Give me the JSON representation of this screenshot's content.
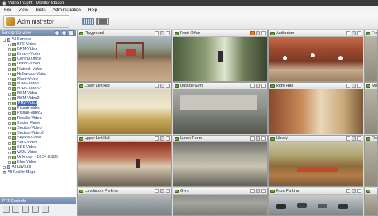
{
  "window": {
    "title": "Video Insight - Monitor Station"
  },
  "menu": [
    "File",
    "View",
    "Tools",
    "Administration",
    "Help"
  ],
  "toolbar": {
    "mode_label": "Administrator"
  },
  "sidebar": {
    "header": "Enterprise view",
    "tree": {
      "root": "All Servers",
      "servers": [
        "BFE-Video",
        "BPM-Video",
        "Bryant-Video",
        "Central Office",
        "Dalton-Video",
        "Flatrock-Video",
        "Hollywood-Video",
        "Mace-Video",
        "NJHS-Video",
        "NJHS-Video2",
        "NSM-Video",
        "NSM-Video2",
        "PRV-Video",
        "Pisgah-Video",
        "Pisgah-Video2",
        "Rosalie-Video",
        "Sevier-Video",
        "Section-Video",
        "Section-Video2",
        "Skyline-Video",
        "SMS-Video",
        "SES-Video",
        "WDV-Video",
        "Unknown - 10.34.8.100",
        "Blue-Video"
      ],
      "selected": "PRV-Video",
      "extra": [
        "All Layouts",
        "All Facility Maps"
      ]
    },
    "ptz_header": "PTZ Controls"
  },
  "cameras": [
    {
      "name": "Playground",
      "recording": false
    },
    {
      "name": "Front Office",
      "recording": true
    },
    {
      "name": "Auditorium",
      "recording": false
    },
    {
      "name": "Fro",
      "recording": false
    },
    {
      "name": "Lower Left Hall",
      "recording": false
    },
    {
      "name": "Outside Gym",
      "recording": false
    },
    {
      "name": "Right Hall",
      "recording": false
    },
    {
      "name": "Ma",
      "recording": false
    },
    {
      "name": "Upper Left Hall",
      "recording": false
    },
    {
      "name": "Lunch Room",
      "recording": false
    },
    {
      "name": "Library",
      "recording": false
    },
    {
      "name": "Re",
      "recording": false
    },
    {
      "name": "Lunchroom Parking",
      "recording": false
    },
    {
      "name": "Gym",
      "recording": false
    },
    {
      "name": "Front Parking",
      "recording": false
    },
    {
      "name": "",
      "recording": false
    }
  ]
}
